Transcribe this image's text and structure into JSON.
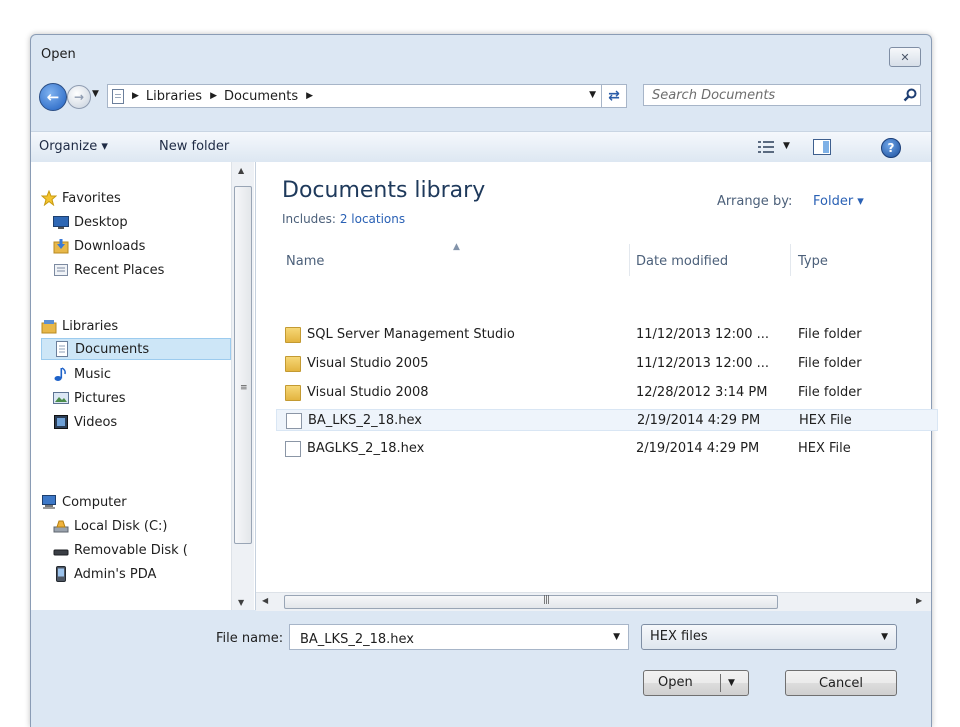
{
  "window": {
    "title": "Open",
    "close_label": "✕"
  },
  "nav": {
    "breadcrumb": [
      "Libraries",
      "Documents"
    ],
    "search_placeholder": "Search Documents"
  },
  "toolbar": {
    "organize": "Organize ▾",
    "new_folder": "New folder"
  },
  "sidebar": {
    "items": [
      {
        "label": "Favorites",
        "icon": "star-icon"
      },
      {
        "label": "Desktop",
        "icon": "desktop-icon"
      },
      {
        "label": "Downloads",
        "icon": "downloads-icon"
      },
      {
        "label": "Recent Places",
        "icon": "recent-places-icon"
      },
      {
        "label": "Libraries",
        "icon": "libraries-icon"
      },
      {
        "label": "Documents",
        "icon": "documents-icon",
        "selected": true
      },
      {
        "label": "Music",
        "icon": "music-icon"
      },
      {
        "label": "Pictures",
        "icon": "pictures-icon"
      },
      {
        "label": "Videos",
        "icon": "videos-icon"
      },
      {
        "label": "Computer",
        "icon": "computer-icon"
      },
      {
        "label": "Local Disk (C:)",
        "icon": "local-disk-icon"
      },
      {
        "label": "Removable Disk (",
        "icon": "removable-disk-icon"
      },
      {
        "label": "Admin's PDA",
        "icon": "pda-icon"
      }
    ]
  },
  "library": {
    "title": "Documents library",
    "includes_label": "Includes:",
    "includes_link": "2 locations",
    "arrange_label": "Arrange by:",
    "arrange_value": "Folder ▾"
  },
  "columns": {
    "name": "Name",
    "date": "Date modified",
    "type": "Type"
  },
  "files": [
    {
      "name": "SQL Server Management Studio",
      "date": "11/12/2013 12:00 ...",
      "type": "File folder",
      "kind": "folder"
    },
    {
      "name": "Visual Studio 2005",
      "date": "11/12/2013 12:00 ...",
      "type": "File folder",
      "kind": "folder"
    },
    {
      "name": "Visual Studio 2008",
      "date": "12/28/2012 3:14 PM",
      "type": "File folder",
      "kind": "folder"
    },
    {
      "name": "BA_LKS_2_18.hex",
      "date": "2/19/2014 4:29 PM",
      "type": "HEX File",
      "kind": "file",
      "hover": true
    },
    {
      "name": "BAGLKS_2_18.hex",
      "date": "2/19/2014 4:29 PM",
      "type": "HEX File",
      "kind": "file"
    }
  ],
  "footer": {
    "file_name_label": "File name:",
    "file_name_value": "BA_LKS_2_18.hex",
    "file_type": "HEX files",
    "open_label": "Open",
    "cancel_label": "Cancel"
  }
}
